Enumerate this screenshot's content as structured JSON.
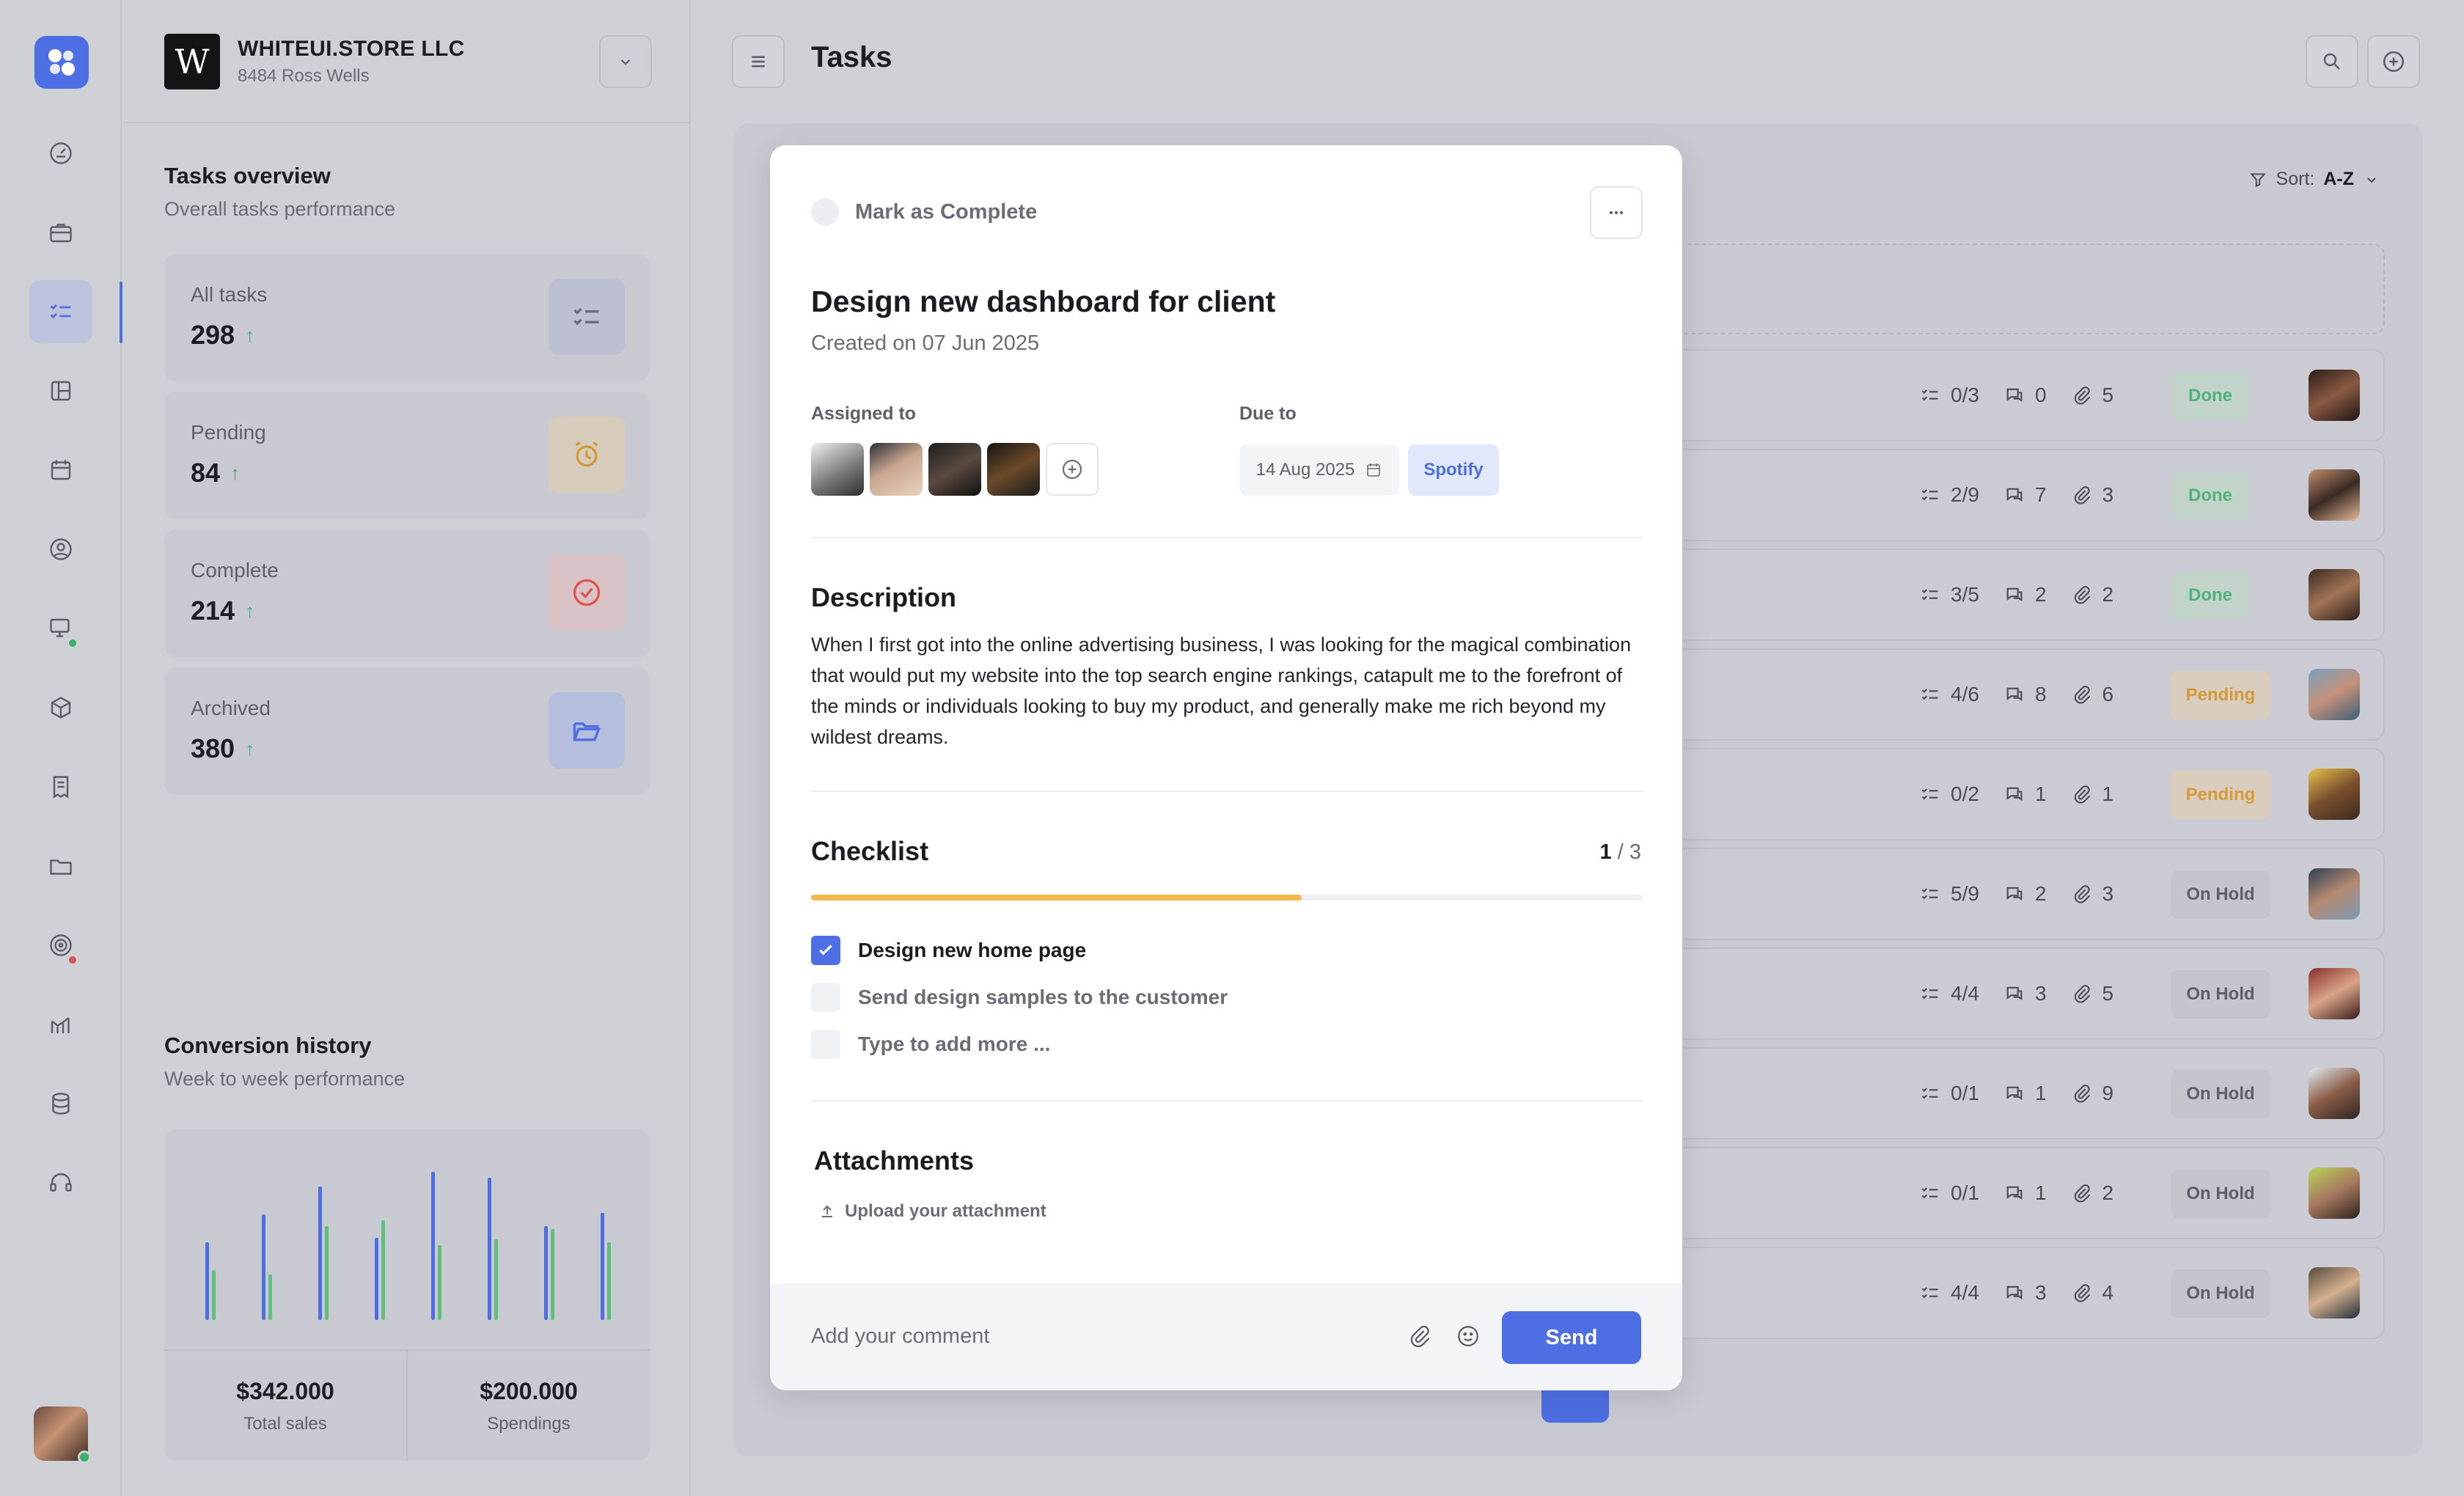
{
  "company": {
    "initial": "W",
    "name": "WHITEUI.STORE LLC",
    "address": "8484 Ross Wells"
  },
  "overview": {
    "title": "Tasks overview",
    "subtitle": "Overall tasks performance",
    "stats": [
      {
        "label": "All tasks",
        "value": "298",
        "icon": "checklist-icon"
      },
      {
        "label": "Pending",
        "value": "84",
        "icon": "alarm-clock-icon"
      },
      {
        "label": "Complete",
        "value": "214",
        "icon": "check-circle-icon"
      },
      {
        "label": "Archived",
        "value": "380",
        "icon": "folder-open-icon"
      }
    ]
  },
  "conversion": {
    "title": "Conversion history",
    "subtitle": "Week to week performance",
    "total_sales": "$342.000",
    "total_sales_label": "Total sales",
    "spendings": "$200.000",
    "spendings_label": "Spendings"
  },
  "chart_data": {
    "type": "bar",
    "categories": [
      "",
      "",
      "",
      "",
      "",
      "",
      "",
      ""
    ],
    "series": [
      {
        "values": [
          53,
          72,
          91,
          56,
          101,
          97,
          64,
          73
        ]
      },
      {
        "values": [
          34,
          31,
          64,
          68,
          51,
          55,
          62,
          53
        ]
      }
    ],
    "ylim": [
      0,
      110
    ],
    "colors": [
      "#4e6fe3",
      "#5fc07e"
    ]
  },
  "header": {
    "title": "Tasks"
  },
  "sort": {
    "label": "Sort:",
    "value": "A-Z"
  },
  "rows": [
    {
      "checklist": "0/3",
      "comments": "0",
      "attachments": "5",
      "status": "Done"
    },
    {
      "checklist": "2/9",
      "comments": "7",
      "attachments": "3",
      "status": "Done"
    },
    {
      "checklist": "3/5",
      "comments": "2",
      "attachments": "2",
      "status": "Done"
    },
    {
      "checklist": "4/6",
      "comments": "8",
      "attachments": "6",
      "status": "Pending"
    },
    {
      "checklist": "0/2",
      "comments": "1",
      "attachments": "1",
      "status": "Pending"
    },
    {
      "checklist": "5/9",
      "comments": "2",
      "attachments": "3",
      "status": "On Hold"
    },
    {
      "checklist": "4/4",
      "comments": "3",
      "attachments": "5",
      "status": "On Hold"
    },
    {
      "checklist": "0/1",
      "comments": "1",
      "attachments": "9",
      "status": "On Hold"
    },
    {
      "checklist": "0/1",
      "comments": "1",
      "attachments": "2",
      "status": "On Hold"
    },
    {
      "checklist": "4/4",
      "comments": "3",
      "attachments": "4",
      "status": "On Hold"
    }
  ],
  "colors": {
    "accent": "#4e6fe3",
    "done_bg": "#c2d3c9",
    "done_fg": "#4fb37a",
    "pending_bg": "#d9cdbd",
    "pending_fg": "#d59a3a",
    "hold_bg": "#c3c4cc",
    "hold_fg": "#5e6069",
    "progress": "#f4b84f"
  },
  "modal": {
    "mark_complete": "Mark as Complete",
    "title": "Design new dashboard for client",
    "created": "Created on 07 Jun 2025",
    "assigned_label": "Assigned to",
    "due_label": "Due to",
    "due_date": "14 Aug 2025",
    "tag": "Spotify",
    "description_title": "Description",
    "description": "When I first got into the online advertising business, I was looking for the magical combination that would put my website into the top search engine rankings, catapult me to the forefront of the minds or individuals looking to buy my product, and generally make me rich beyond my wildest dreams.",
    "checklist_title": "Checklist",
    "checklist_done": "1",
    "checklist_total": "/ 3",
    "checklist_progress": 0.59,
    "checklist": [
      {
        "label": "Design new home page",
        "checked": true
      },
      {
        "label": "Send design samples to the customer",
        "checked": false
      }
    ],
    "checklist_add_placeholder": "Type to add more ...",
    "attachments_title": "Attachments",
    "upload_label": "Upload your attachment",
    "comment_placeholder": "Add your comment",
    "send_label": "Send"
  }
}
